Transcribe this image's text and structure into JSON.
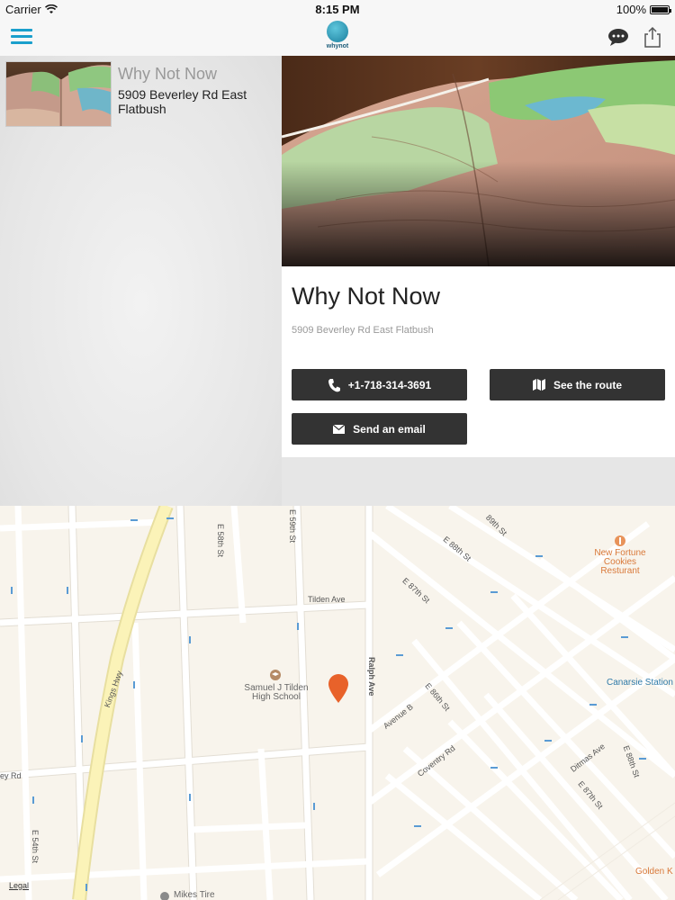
{
  "status_bar": {
    "carrier": "Carrier",
    "time": "8:15 PM",
    "battery": "100%"
  },
  "nav": {
    "logo_text": "whynot"
  },
  "list": {
    "items": [
      {
        "title": "Why Not Now",
        "address": "5909 Beverley Rd East Flatbush"
      }
    ]
  },
  "detail": {
    "title": "Why Not Now",
    "address": "5909 Beverley Rd East Flatbush",
    "phone_label": "+1-718-314-3691",
    "route_label": "See the route",
    "email_label": "Send an email"
  },
  "map": {
    "streets": {
      "e58": "E 58th St",
      "e59": "E 59th St",
      "e89": "89th St",
      "e88": "E 88th St",
      "e87": "E 87th St",
      "e86": "E 86th St",
      "e87b": "E 87th St",
      "e88b": "E 88th St",
      "e54": "E 54th St",
      "tilden": "Tilden Ave",
      "ralph": "Ralph Ave",
      "kings": "Kings Hwy",
      "avenue_b": "Avenue B",
      "coventry": "Coventry Rd",
      "ditmas": "Ditmas Ave",
      "beverley": "ey Rd"
    },
    "pois": {
      "school": "Samuel J Tilden\nHigh School",
      "cookies": "New Fortune\nCookies\nResturant",
      "canarsie": "Canarsie Station",
      "golden": "Golden K",
      "mikes": "Mikes Tire"
    },
    "legal": "Legal"
  },
  "colors": {
    "accent": "#1a9fcc",
    "button_bg": "#333333",
    "map_bg": "#f8f4ec",
    "map_road": "#ffffff",
    "map_pin": "#e8622a",
    "highway": "#fbf3b8"
  }
}
